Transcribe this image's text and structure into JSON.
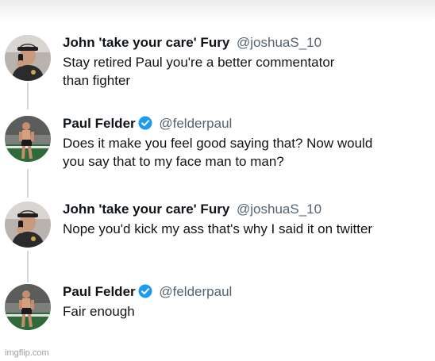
{
  "tweets": [
    {
      "name": "John 'take your care' Fury",
      "handle": "@joshuaS_10",
      "verified": false,
      "avatar_icon": "person-phone-avatar",
      "lines": [
        "Stay retired Paul you're a better commentator",
        "than fighter"
      ]
    },
    {
      "name": "Paul Felder",
      "handle": "@felderpaul",
      "verified": true,
      "avatar_icon": "fighter-avatar",
      "lines": [
        "Does it make you feel good saying that? Now would",
        "you say that to my face man to man?"
      ]
    },
    {
      "name": "John 'take your care' Fury",
      "handle": "@joshuaS_10",
      "verified": false,
      "avatar_icon": "person-phone-avatar",
      "lines": [
        "Nope you'd kick my ass that's why I said it on twitter"
      ]
    },
    {
      "name": "Paul Felder",
      "handle": "@felderpaul",
      "verified": true,
      "avatar_icon": "fighter-avatar",
      "lines": [
        "Fair enough"
      ]
    }
  ],
  "watermark": "imgflip.com",
  "colors": {
    "verified_blue": "#1d9bf0",
    "handle_gray": "#536471",
    "thread_line": "#cfd9de"
  }
}
